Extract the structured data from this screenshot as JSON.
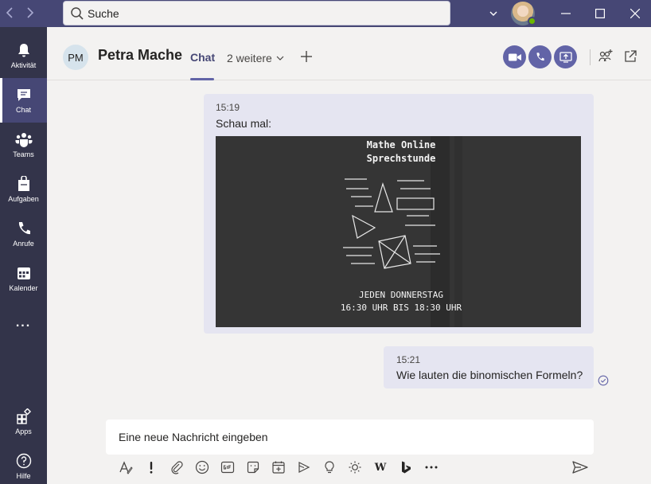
{
  "window": {
    "search_placeholder": "Suche",
    "nav_back_icon": "chevron-left-icon",
    "nav_forward_icon": "chevron-right-icon"
  },
  "rail": {
    "items": [
      {
        "label": "Aktivität",
        "icon": "bell-icon"
      },
      {
        "label": "Chat",
        "icon": "chat-icon",
        "active": true
      },
      {
        "label": "Teams",
        "icon": "teams-icon"
      },
      {
        "label": "Aufgaben",
        "icon": "assignments-icon"
      },
      {
        "label": "Anrufe",
        "icon": "phone-icon"
      },
      {
        "label": "Kalender",
        "icon": "calendar-icon"
      }
    ],
    "more_label": "...",
    "apps_label": "Apps",
    "help_label": "Hilfe"
  },
  "header": {
    "contact_initials": "PM",
    "contact_name": "Petra Mache",
    "tab_chat": "Chat",
    "tab_more": "2 weitere"
  },
  "messages": [
    {
      "time": "15:19",
      "text": "Schau mal:",
      "image": {
        "title_line1": "Mathe Online",
        "title_line2": "Sprechstunde",
        "footer_line1": "JEDEN DONNERSTAG",
        "footer_line2": "16:30 UHR BIS 18:30 UHR"
      }
    },
    {
      "time": "15:21",
      "text": "Wie lauten die binomischen Formeln?"
    }
  ],
  "compose": {
    "placeholder": "Eine neue Nachricht eingeben"
  },
  "colors": {
    "titlebar": "#464775",
    "rail": "#33344a",
    "accent": "#6264a7",
    "bubble": "#e5e5f1"
  }
}
